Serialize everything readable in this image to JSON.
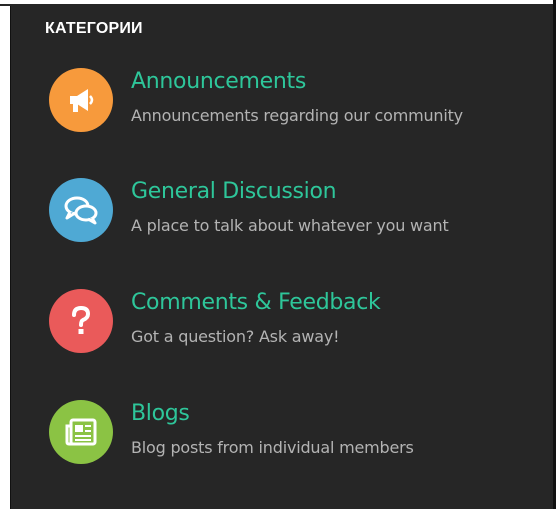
{
  "heading": "КАТЕГОРИИ",
  "categories": [
    {
      "title": "Announcements",
      "description": "Announcements regarding our community",
      "icon": "megaphone-icon",
      "color": "#f79a3c"
    },
    {
      "title": "General Discussion",
      "description": "A place to talk about whatever you want",
      "icon": "chat-bubbles-icon",
      "color": "#4fa9d4"
    },
    {
      "title": "Comments & Feedback",
      "description": "Got a question? Ask away!",
      "icon": "question-mark-icon",
      "color": "#ea5a5a"
    },
    {
      "title": "Blogs",
      "description": "Blog posts from individual members",
      "icon": "newspaper-icon",
      "color": "#8bc344"
    }
  ],
  "colors": {
    "background": "#262626",
    "title": "#2ec69a",
    "description": "#b3b3b3"
  }
}
